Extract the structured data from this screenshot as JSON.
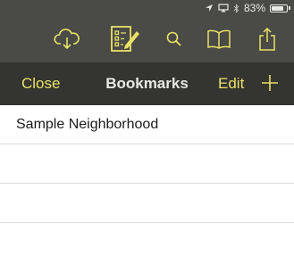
{
  "status_bar": {
    "battery_text": "83%",
    "battery_level": 0.83,
    "icons": [
      "location-arrow-icon",
      "airplay-icon",
      "bluetooth-icon",
      "battery-icon"
    ]
  },
  "toolbar": {
    "icons": [
      "cloud-download-icon",
      "checklist-edit-icon",
      "search-icon",
      "book-icon",
      "share-icon"
    ],
    "background": "#4a4a47",
    "icon_color": "#e8e266"
  },
  "nav": {
    "close_label": "Close",
    "title": "Bookmarks",
    "edit_label": "Edit",
    "add_icon": "plus-icon",
    "background": "#343431",
    "accent": "#e8e266"
  },
  "bookmarks": {
    "items": [
      {
        "label": "Sample Neighborhood"
      }
    ]
  }
}
